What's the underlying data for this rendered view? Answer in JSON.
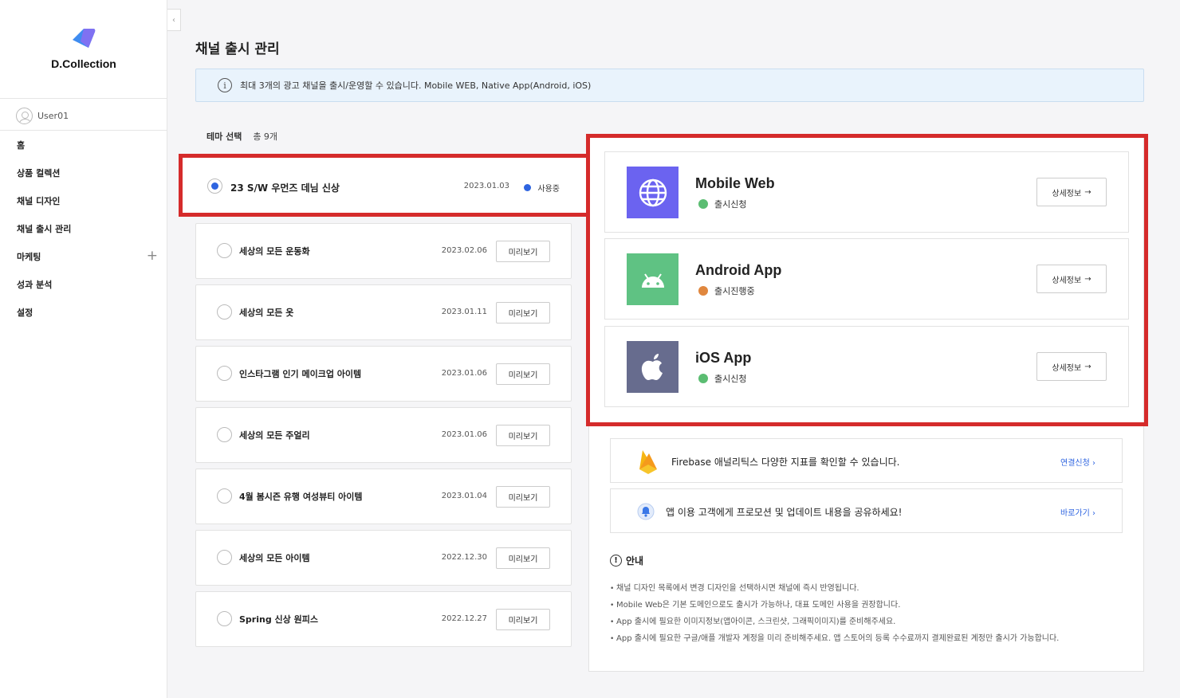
{
  "sidebar": {
    "brand": "D.Collection",
    "user": "User01",
    "collapse_glyph": "‹",
    "items": [
      {
        "label": "홈"
      },
      {
        "label": "상품 컬렉션"
      },
      {
        "label": "채널 디자인"
      },
      {
        "label": "채널 출시 관리"
      },
      {
        "label": "마케팅",
        "expand": "+"
      },
      {
        "label": "성과 분석"
      },
      {
        "label": "설정"
      }
    ]
  },
  "main": {
    "title": "채널 출시 관리",
    "info_icon": "i",
    "info_text": "최대 3개의 광고 채널을 출시/운영할 수 있습니다. Mobile WEB, Native App(Android, iOS)",
    "theme_section_label": "테마 선택",
    "theme_count": "총 9개",
    "selected_theme": {
      "name": "23 S/W 우먼즈 데님 신상",
      "date": "2023.01.03",
      "status": "사용중",
      "status_color": "#2e64e0"
    },
    "preview_label": "미리보기",
    "themes": [
      {
        "name": "세상의 모든 운동화",
        "date": "2023.02.06"
      },
      {
        "name": "세상의 모든 옷",
        "date": "2023.01.11"
      },
      {
        "name": "인스타그램 인기 메이크업 아이템",
        "date": "2023.01.06"
      },
      {
        "name": "세상의 모든 주얼리",
        "date": "2023.01.06"
      },
      {
        "name": "4월 봄시즌 유행 여성뷰티 아이템",
        "date": "2023.01.04"
      },
      {
        "name": "세상의 모든 아이템",
        "date": "2022.12.30"
      },
      {
        "name": "Spring 신상 원피스",
        "date": "2022.12.27"
      }
    ]
  },
  "channels": {
    "detail_label": "상세정보",
    "detail_arrow": "→",
    "items": [
      {
        "name": "Mobile Web",
        "status": "출시신청",
        "status_color": "#5bbd72",
        "icon": "globe-icon",
        "icon_bg": "#6b63f0"
      },
      {
        "name": "Android App",
        "status": "출시진행중",
        "status_color": "#e0873e",
        "icon": "android-icon",
        "icon_bg": "#5fc283"
      },
      {
        "name": "iOS App",
        "status": "출시신청",
        "status_color": "#5bbd72",
        "icon": "apple-icon",
        "icon_bg": "#676c8e"
      }
    ]
  },
  "promos": [
    {
      "text": "Firebase 애널리틱스 다양한 지표를 확인할 수 있습니다.",
      "link": "연결신청 ›",
      "icon": "firebase-icon"
    },
    {
      "text": "앱 이용 고객에게 프로모션 및 업데이트 내용을 공유하세요!",
      "link": "바로가기 ›",
      "icon": "bell-icon"
    }
  ],
  "notice": {
    "icon": "!",
    "title": "안내",
    "items": [
      "채널 디자인 목록에서 변경 디자인을 선택하시면 채널에 즉시 반영됩니다.",
      "Mobile Web은 기본 도메인으로도 출시가 가능하나, 대표 도메인 사용을 권장합니다.",
      "App 출시에 필요한 이미지정보(앱아이콘, 스크린샷, 그래픽이미지)를 준비해주세요.",
      "App 출시에 필요한 구글/애플 개발자 계정을 미리 준비해주세요. 앱 스토어의 등록 수수료까지 결제완료된 계정만 출시가 가능합니다."
    ]
  }
}
